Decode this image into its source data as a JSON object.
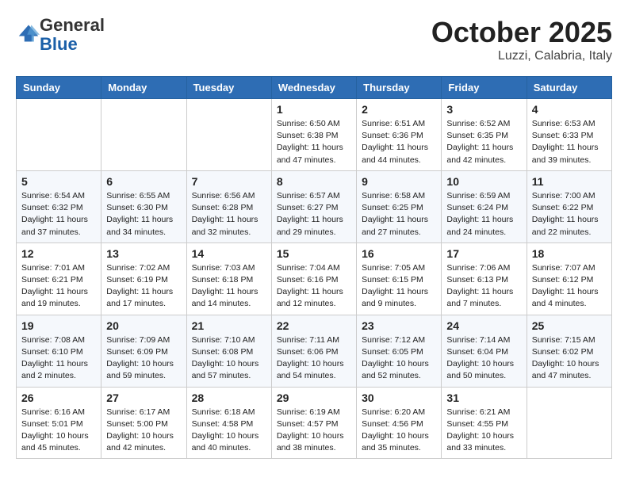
{
  "header": {
    "logo_general": "General",
    "logo_blue": "Blue",
    "month": "October 2025",
    "location": "Luzzi, Calabria, Italy"
  },
  "weekdays": [
    "Sunday",
    "Monday",
    "Tuesday",
    "Wednesday",
    "Thursday",
    "Friday",
    "Saturday"
  ],
  "weeks": [
    [
      {
        "day": "",
        "info": ""
      },
      {
        "day": "",
        "info": ""
      },
      {
        "day": "",
        "info": ""
      },
      {
        "day": "1",
        "info": "Sunrise: 6:50 AM\nSunset: 6:38 PM\nDaylight: 11 hours and 47 minutes."
      },
      {
        "day": "2",
        "info": "Sunrise: 6:51 AM\nSunset: 6:36 PM\nDaylight: 11 hours and 44 minutes."
      },
      {
        "day": "3",
        "info": "Sunrise: 6:52 AM\nSunset: 6:35 PM\nDaylight: 11 hours and 42 minutes."
      },
      {
        "day": "4",
        "info": "Sunrise: 6:53 AM\nSunset: 6:33 PM\nDaylight: 11 hours and 39 minutes."
      }
    ],
    [
      {
        "day": "5",
        "info": "Sunrise: 6:54 AM\nSunset: 6:32 PM\nDaylight: 11 hours and 37 minutes."
      },
      {
        "day": "6",
        "info": "Sunrise: 6:55 AM\nSunset: 6:30 PM\nDaylight: 11 hours and 34 minutes."
      },
      {
        "day": "7",
        "info": "Sunrise: 6:56 AM\nSunset: 6:28 PM\nDaylight: 11 hours and 32 minutes."
      },
      {
        "day": "8",
        "info": "Sunrise: 6:57 AM\nSunset: 6:27 PM\nDaylight: 11 hours and 29 minutes."
      },
      {
        "day": "9",
        "info": "Sunrise: 6:58 AM\nSunset: 6:25 PM\nDaylight: 11 hours and 27 minutes."
      },
      {
        "day": "10",
        "info": "Sunrise: 6:59 AM\nSunset: 6:24 PM\nDaylight: 11 hours and 24 minutes."
      },
      {
        "day": "11",
        "info": "Sunrise: 7:00 AM\nSunset: 6:22 PM\nDaylight: 11 hours and 22 minutes."
      }
    ],
    [
      {
        "day": "12",
        "info": "Sunrise: 7:01 AM\nSunset: 6:21 PM\nDaylight: 11 hours and 19 minutes."
      },
      {
        "day": "13",
        "info": "Sunrise: 7:02 AM\nSunset: 6:19 PM\nDaylight: 11 hours and 17 minutes."
      },
      {
        "day": "14",
        "info": "Sunrise: 7:03 AM\nSunset: 6:18 PM\nDaylight: 11 hours and 14 minutes."
      },
      {
        "day": "15",
        "info": "Sunrise: 7:04 AM\nSunset: 6:16 PM\nDaylight: 11 hours and 12 minutes."
      },
      {
        "day": "16",
        "info": "Sunrise: 7:05 AM\nSunset: 6:15 PM\nDaylight: 11 hours and 9 minutes."
      },
      {
        "day": "17",
        "info": "Sunrise: 7:06 AM\nSunset: 6:13 PM\nDaylight: 11 hours and 7 minutes."
      },
      {
        "day": "18",
        "info": "Sunrise: 7:07 AM\nSunset: 6:12 PM\nDaylight: 11 hours and 4 minutes."
      }
    ],
    [
      {
        "day": "19",
        "info": "Sunrise: 7:08 AM\nSunset: 6:10 PM\nDaylight: 11 hours and 2 minutes."
      },
      {
        "day": "20",
        "info": "Sunrise: 7:09 AM\nSunset: 6:09 PM\nDaylight: 10 hours and 59 minutes."
      },
      {
        "day": "21",
        "info": "Sunrise: 7:10 AM\nSunset: 6:08 PM\nDaylight: 10 hours and 57 minutes."
      },
      {
        "day": "22",
        "info": "Sunrise: 7:11 AM\nSunset: 6:06 PM\nDaylight: 10 hours and 54 minutes."
      },
      {
        "day": "23",
        "info": "Sunrise: 7:12 AM\nSunset: 6:05 PM\nDaylight: 10 hours and 52 minutes."
      },
      {
        "day": "24",
        "info": "Sunrise: 7:14 AM\nSunset: 6:04 PM\nDaylight: 10 hours and 50 minutes."
      },
      {
        "day": "25",
        "info": "Sunrise: 7:15 AM\nSunset: 6:02 PM\nDaylight: 10 hours and 47 minutes."
      }
    ],
    [
      {
        "day": "26",
        "info": "Sunrise: 6:16 AM\nSunset: 5:01 PM\nDaylight: 10 hours and 45 minutes."
      },
      {
        "day": "27",
        "info": "Sunrise: 6:17 AM\nSunset: 5:00 PM\nDaylight: 10 hours and 42 minutes."
      },
      {
        "day": "28",
        "info": "Sunrise: 6:18 AM\nSunset: 4:58 PM\nDaylight: 10 hours and 40 minutes."
      },
      {
        "day": "29",
        "info": "Sunrise: 6:19 AM\nSunset: 4:57 PM\nDaylight: 10 hours and 38 minutes."
      },
      {
        "day": "30",
        "info": "Sunrise: 6:20 AM\nSunset: 4:56 PM\nDaylight: 10 hours and 35 minutes."
      },
      {
        "day": "31",
        "info": "Sunrise: 6:21 AM\nSunset: 4:55 PM\nDaylight: 10 hours and 33 minutes."
      },
      {
        "day": "",
        "info": ""
      }
    ]
  ]
}
